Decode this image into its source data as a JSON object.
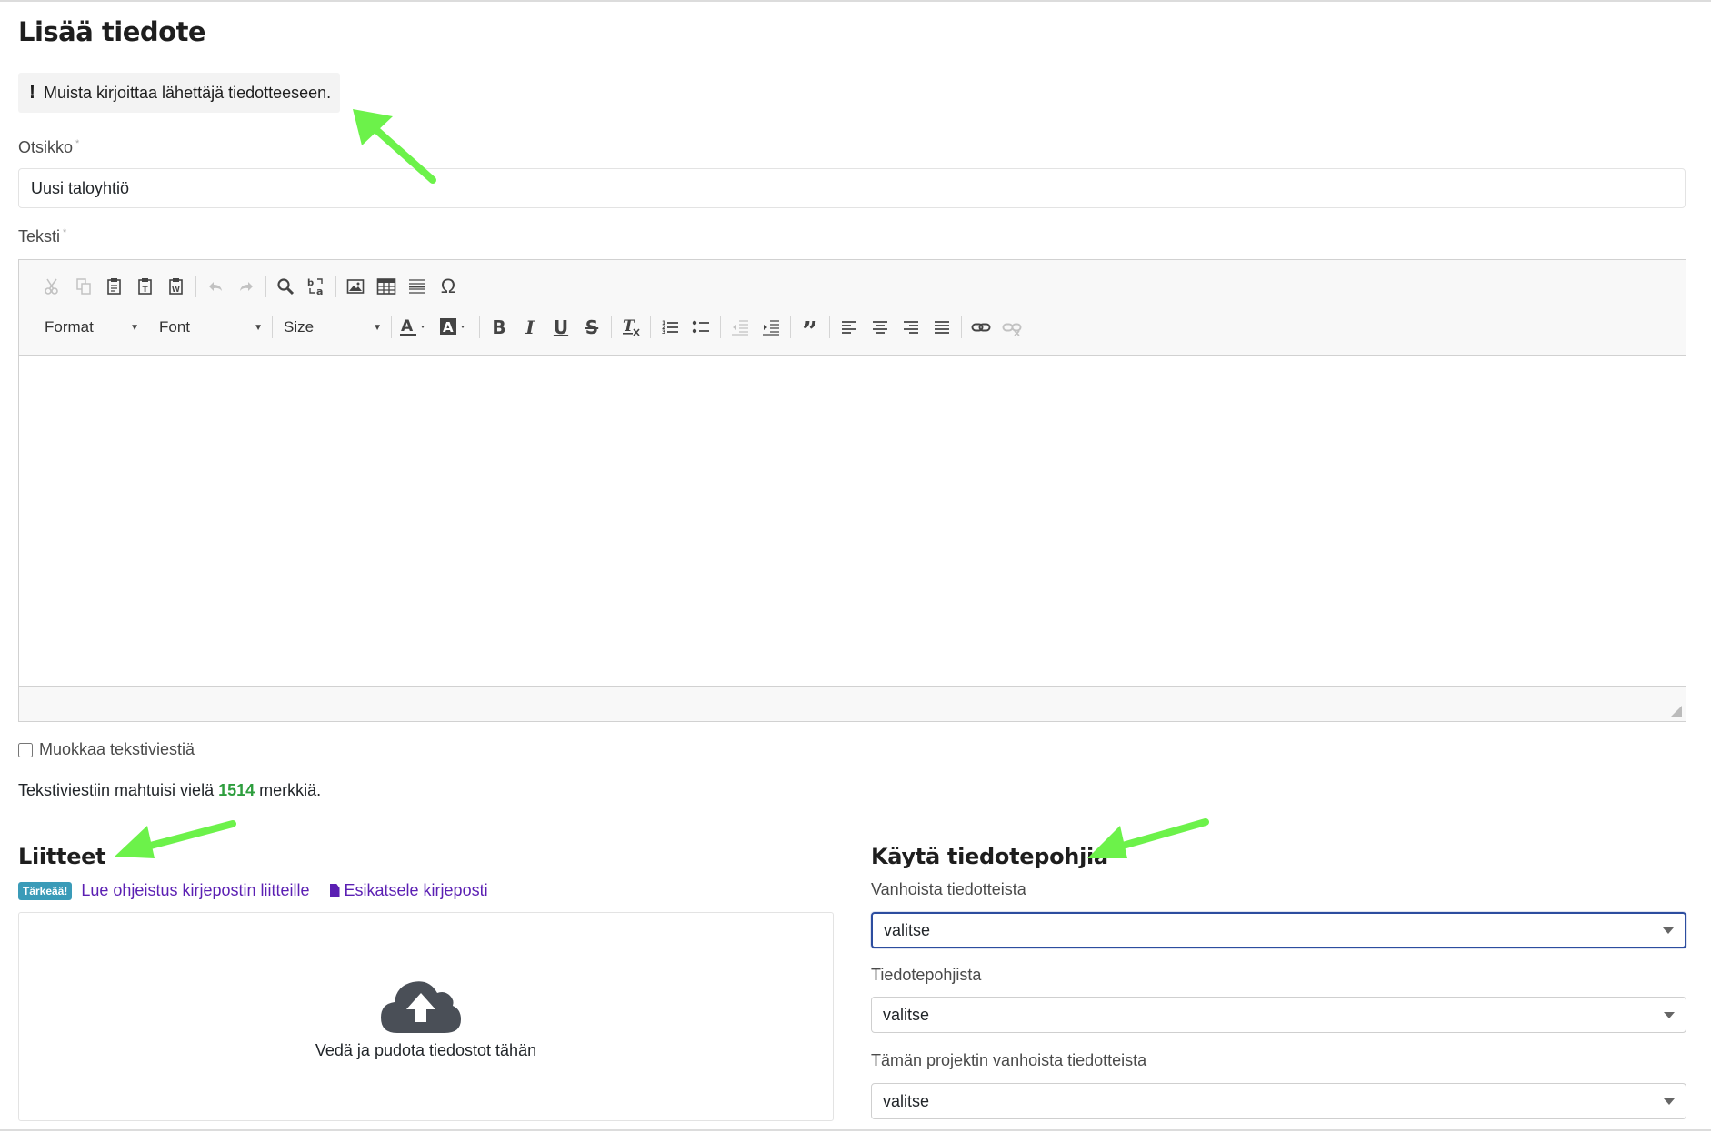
{
  "page": {
    "title": "Lisää tiedote"
  },
  "notice": {
    "icon": "exclamation-icon",
    "text": "Muista kirjoittaa lähettäjä tiedotteeseen."
  },
  "title_field": {
    "label": "Otsikko",
    "required_mark": "*",
    "value": "Uusi taloyhtiö"
  },
  "text_field": {
    "label": "Teksti",
    "required_mark": "*"
  },
  "editor": {
    "toolbar_row1": [
      "cut-icon",
      "copy-icon",
      "paste-icon",
      "paste-text-icon",
      "paste-word-icon",
      "undo-icon",
      "redo-icon",
      "find-icon",
      "replace-icon",
      "image-icon",
      "table-icon",
      "horizontal-line-icon",
      "special-character-icon"
    ],
    "format_label": "Format",
    "font_label": "Font",
    "size_label": "Size",
    "toolbar_row2": [
      "text-color-icon",
      "background-color-icon",
      "bold-icon",
      "italic-icon",
      "underline-icon",
      "strikethrough-icon",
      "remove-format-icon",
      "numbered-list-icon",
      "bulleted-list-icon",
      "decrease-indent-icon",
      "increase-indent-icon",
      "blockquote-icon",
      "align-left-icon",
      "align-center-icon",
      "align-right-icon",
      "justify-icon",
      "link-icon",
      "unlink-icon"
    ]
  },
  "sms": {
    "checkbox_label": "Muokkaa tekstiviestiä",
    "prefix": "Tekstiviestiin mahtuisi vielä",
    "count": "1514",
    "suffix": "merkkiä."
  },
  "attachments": {
    "heading": "Liitteet",
    "badge": "Tärkeää!",
    "guide_link": "Lue ohjeistus kirjepostin liitteille",
    "preview_link": "Esikatsele kirjeposti",
    "dropzone_text": "Vedä ja pudota tiedostot tähän"
  },
  "templates": {
    "heading": "Käytä tiedotepohjia",
    "fields": [
      {
        "label": "Vanhoista tiedotteista",
        "value": "valitse"
      },
      {
        "label": "Tiedotepohjista",
        "value": "valitse"
      },
      {
        "label": "Tämän projektin vanhoista tiedotteista",
        "value": "valitse"
      }
    ]
  },
  "colors": {
    "accent": "#2c4d9f",
    "link": "#5b1fb3",
    "count": "#2e9e3e",
    "badge": "#3a9bb8",
    "annotation_arrow": "#6cf24a"
  }
}
